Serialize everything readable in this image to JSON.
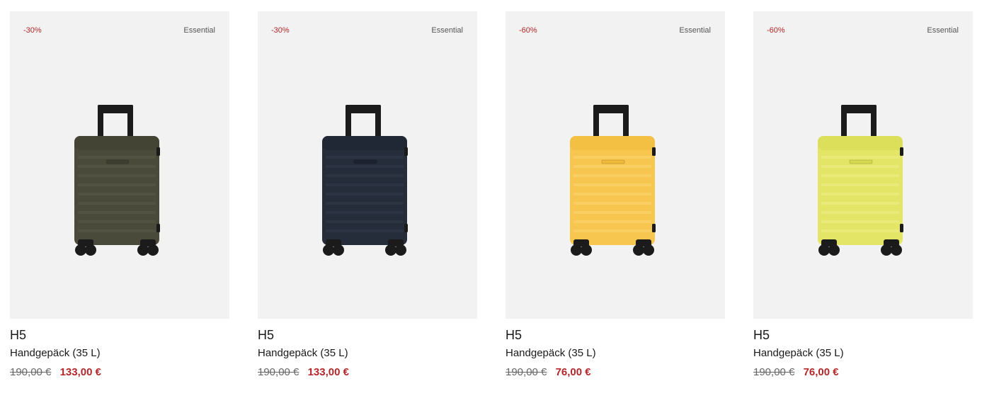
{
  "products": [
    {
      "discount": "-30%",
      "tag": "Essential",
      "model": "H5",
      "description": "Handgepäck (35 L)",
      "old_price": "190,00 €",
      "new_price": "133,00 €",
      "color_name": "dark-olive",
      "body_color": "#4a4a3a",
      "body_shade": "#3d3d30",
      "rib_color": "#5a5a48"
    },
    {
      "discount": "-30%",
      "tag": "Essential",
      "model": "H5",
      "description": "Handgepäck (35 L)",
      "old_price": "190,00 €",
      "new_price": "133,00 €",
      "color_name": "night-blue",
      "body_color": "#252c3a",
      "body_shade": "#1c2230",
      "rib_color": "#333b4b"
    },
    {
      "discount": "-60%",
      "tag": "Essential",
      "model": "H5",
      "description": "Handgepäck (35 L)",
      "old_price": "190,00 €",
      "new_price": "76,00 €",
      "color_name": "yellow",
      "body_color": "#f7c64f",
      "body_shade": "#f0b93a",
      "rib_color": "#fbd776"
    },
    {
      "discount": "-60%",
      "tag": "Essential",
      "model": "H5",
      "description": "Handgepäck (35 L)",
      "old_price": "190,00 €",
      "new_price": "76,00 €",
      "color_name": "lime",
      "body_color": "#e2e565",
      "body_shade": "#d6d94f",
      "rib_color": "#ecee8a"
    }
  ]
}
